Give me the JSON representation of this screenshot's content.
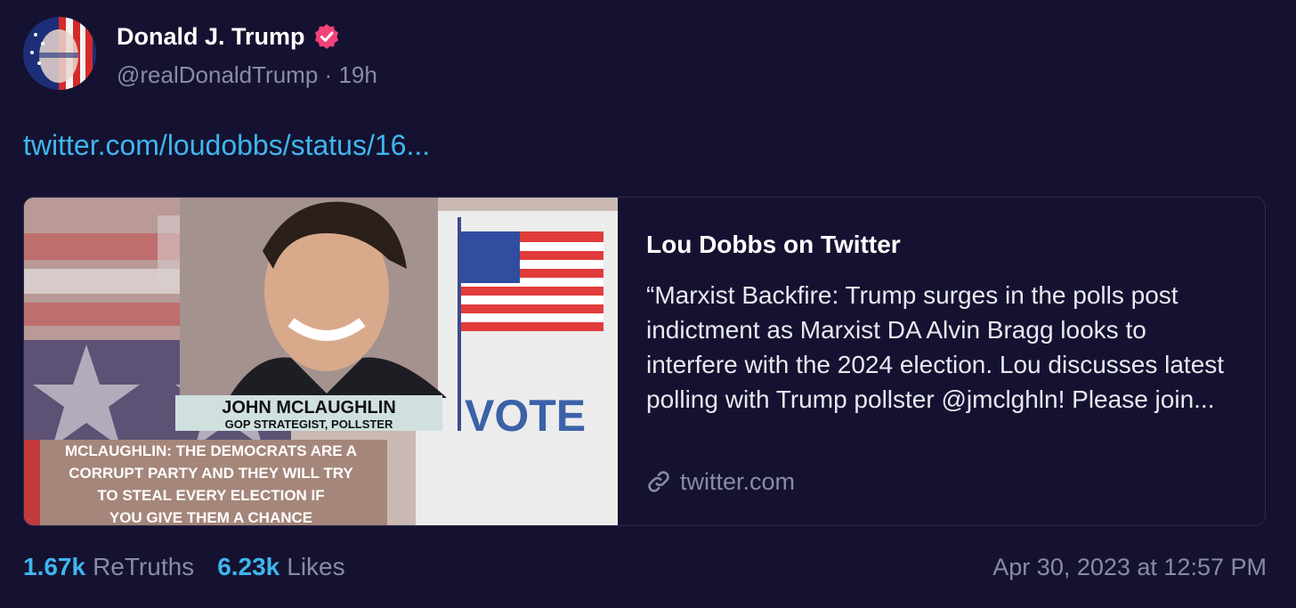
{
  "post": {
    "display_name": "Donald J. Trump",
    "handle": "@realDonaldTrump",
    "separator": "·",
    "age": "19h",
    "link_text": "twitter.com/loudobbs/status/16...",
    "verified_badge": "verified-badge-icon"
  },
  "card": {
    "title": "Lou Dobbs on Twitter",
    "description": "“Marxist Backfire: Trump surges in the polls post indictment as Marxist DA Alvin Bragg looks to interfere with the 2024 election. Lou discusses latest polling with Trump pollster @jmclghln! Please join...",
    "domain": "twitter.com",
    "image": {
      "name_caption": "JOHN MCLAUGHLIN",
      "role_caption": "GOP STRATEGIST, POLLSTER",
      "quote_lines": [
        "MCLAUGHLIN: THE DEMOCRATS ARE A",
        "CORRUPT PARTY AND THEY WILL TRY",
        "TO STEAL EVERY ELECTION IF",
        "YOU GIVE THEM A CHANCE"
      ],
      "vote_sign": "VOTE"
    }
  },
  "stats": {
    "retruths_count": "1.67k",
    "retruths_label": "ReTruths",
    "likes_count": "6.23k",
    "likes_label": "Likes",
    "timestamp": "Apr 30, 2023 at 12:57 PM"
  },
  "colors": {
    "background": "#141230",
    "link": "#3fb6ee",
    "muted": "#8a8aa6",
    "verified": "#f5417a"
  }
}
